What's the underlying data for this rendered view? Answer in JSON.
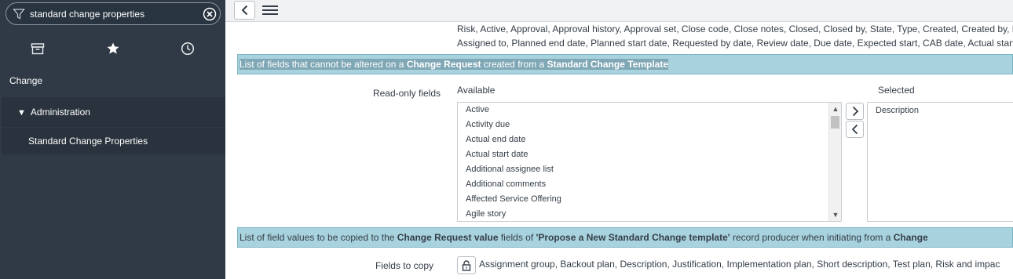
{
  "sidebar": {
    "filter": {
      "value": "standard change properties"
    },
    "application": "Change",
    "module": "Administration",
    "item": "Standard Change Properties"
  },
  "summary": {
    "line1": "Risk, Active, Approval, Approval history, Approval set, Close code, Close notes, Closed, Closed by, State, Type, Created, Created by, D",
    "line2": "Assigned to, Planned end date, Planned start date, Requested by date, Review date, Due date, Expected start, CAB date, Actual start"
  },
  "band1": {
    "pre": "List of fields that cannot be altered on a ",
    "b1": "Change Request",
    "mid": " created from a ",
    "b2": "Standard Change Template"
  },
  "readonly": {
    "label": "Read-only fields",
    "available_label": "Available",
    "selected_label": "Selected",
    "available": [
      "Active",
      "Activity due",
      "Actual end date",
      "Actual start date",
      "Additional assignee list",
      "Additional comments",
      "Affected Service Offering",
      "Agile story"
    ],
    "selected": [
      "Description"
    ]
  },
  "band2": {
    "pre": "List of field values to be copied to the ",
    "b1": "Change Request value",
    "mid": " fields of ",
    "b2": "'Propose a New Standard Change template'",
    "mid2": " record producer when initiating from a ",
    "b3": "Change"
  },
  "fields_to_copy": {
    "label": "Fields to copy",
    "value": "Assignment group, Backout plan, Description, Justification, Implementation plan, Short description, Test plan, Risk and impac"
  }
}
